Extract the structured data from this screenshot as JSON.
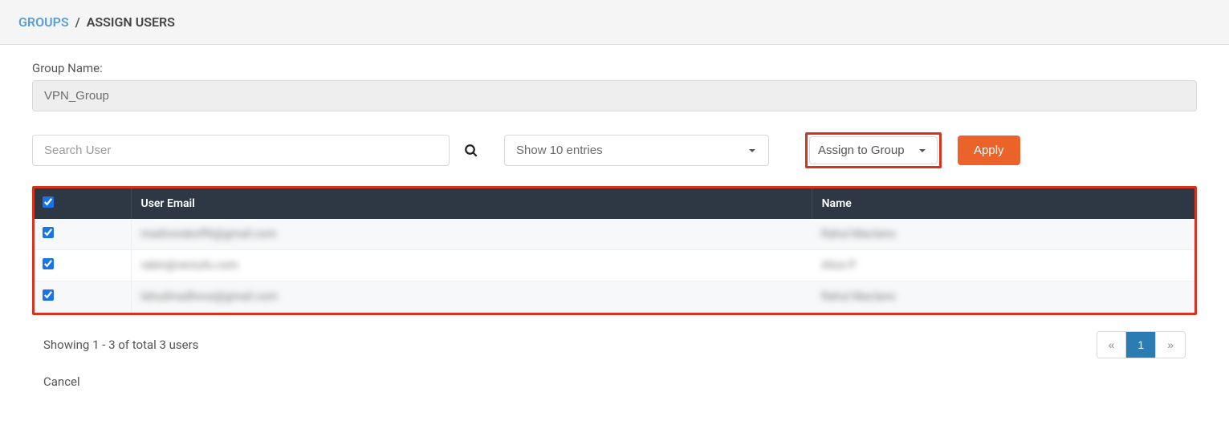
{
  "breadcrumb": {
    "root": "GROUPS",
    "sep": "/",
    "current": "ASSIGN USERS"
  },
  "group_name": {
    "label": "Group Name:",
    "value": "VPN_Group"
  },
  "search": {
    "placeholder": "Search User"
  },
  "entries": {
    "selected": "Show 10 entries"
  },
  "action": {
    "selected": "Assign to Group"
  },
  "apply_label": "Apply",
  "table": {
    "headers": {
      "email": "User Email",
      "name": "Name"
    },
    "select_all_checked": true,
    "rows": [
      {
        "checked": true,
        "email": "madivorakoff6@gmail.com",
        "name": "Rahul Maclano"
      },
      {
        "checked": true,
        "email": "rabin@versufu.com",
        "name": "Alice P"
      },
      {
        "checked": true,
        "email": "lahudmadhova@gmail.com",
        "name": "Rahul Maclano"
      }
    ]
  },
  "footer": {
    "info": "Showing 1 - 3 of total 3 users",
    "prev": "«",
    "page": "1",
    "next": "»"
  },
  "cancel_label": "Cancel"
}
